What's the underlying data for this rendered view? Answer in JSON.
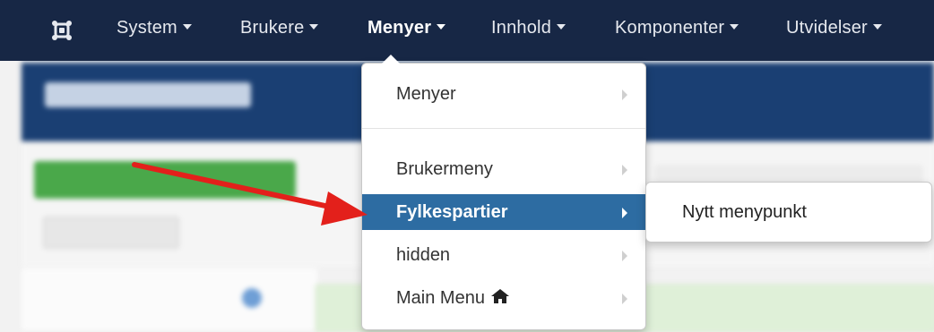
{
  "navbar": {
    "items": [
      {
        "label": "System"
      },
      {
        "label": "Brukere"
      },
      {
        "label": "Menyer"
      },
      {
        "label": "Innhold"
      },
      {
        "label": "Komponenter"
      },
      {
        "label": "Utvidelser"
      }
    ],
    "logo_icon": "joomla-logo-icon",
    "active_item": "Menyer"
  },
  "menu_dropdown": {
    "items": [
      {
        "label": "Menyer"
      },
      {
        "label": "Brukermeny"
      },
      {
        "label": "Fylkespartier"
      },
      {
        "label": "hidden"
      },
      {
        "label": "Main Menu"
      }
    ],
    "highlighted": "Fylkespartier",
    "main_menu_icon": "home-icon"
  },
  "submenu": {
    "items": [
      {
        "label": "Nytt menypunkt"
      }
    ]
  },
  "colors": {
    "navbar": "#172745",
    "header": "#1a3f73",
    "highlight": "#2d6ca2",
    "annotation_arrow": "#e3201b"
  }
}
